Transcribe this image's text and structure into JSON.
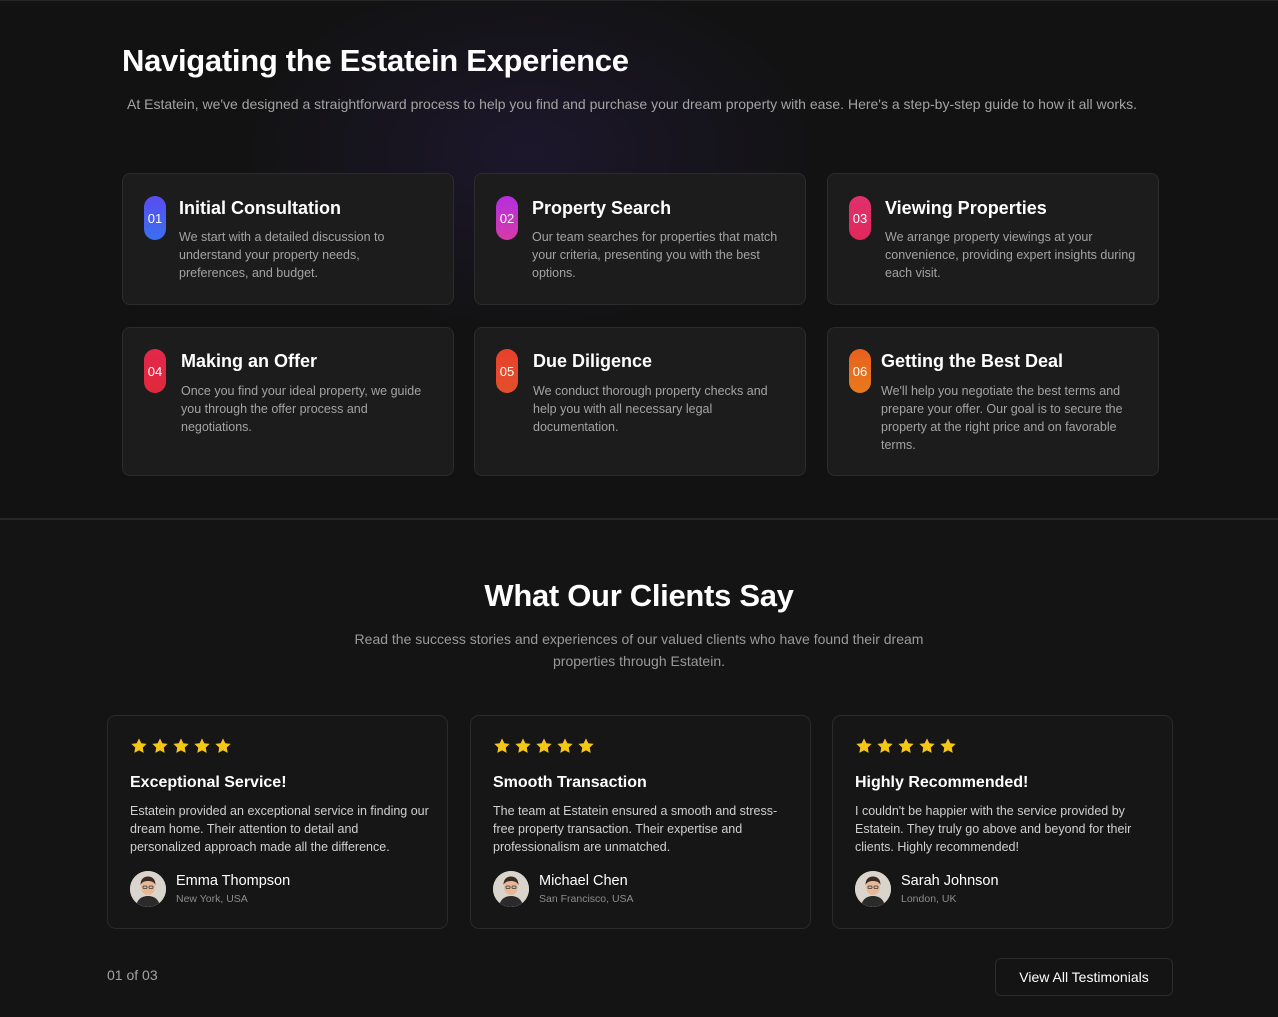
{
  "process": {
    "title": "Navigating the Estatein Experience",
    "subtitle": "At Estatein, we've designed a straightforward process to help you find and purchase your dream property with ease. Here's a step-by-step guide to how it all works.",
    "steps": [
      {
        "num": "01",
        "title": "Initial Consultation",
        "desc": "We start with a detailed discussion to understand your property needs, preferences, and budget.",
        "color_from": "#5a4cf0",
        "color_to": "#3a6ff0"
      },
      {
        "num": "02",
        "title": "Property Search",
        "desc": "Our team searches for properties that match your criteria, presenting you with the best options.",
        "color_from": "#b52ee0",
        "color_to": "#d63aa6"
      },
      {
        "num": "03",
        "title": "Viewing Properties",
        "desc": "We arrange property viewings at your convenience, providing expert insights during each visit.",
        "color_from": "#e0306f",
        "color_to": "#e0285a"
      },
      {
        "num": "04",
        "title": "Making an Offer",
        "desc": "Once you find your ideal property, we guide you through the offer process and negotiations.",
        "color_from": "#e3284a",
        "color_to": "#e0283c"
      },
      {
        "num": "05",
        "title": "Due Diligence",
        "desc": "We conduct thorough property checks and help you with all necessary legal documentation.",
        "color_from": "#e8402c",
        "color_to": "#e2502a"
      },
      {
        "num": "06",
        "title": "Getting the Best Deal",
        "desc": "We'll help you negotiate the best terms and prepare your offer. Our goal is to secure the property at the right price and on favorable terms.",
        "color_from": "#e8601e",
        "color_to": "#e87a1c"
      }
    ]
  },
  "testimonials": {
    "title": "What Our Clients Say",
    "subtitle": "Read the success stories and experiences of our valued clients who have found their dream properties through Estatein.",
    "star_color": "#f5c518",
    "items": [
      {
        "rating": 5,
        "title": "Exceptional Service!",
        "body": "Estatein provided an exceptional service in finding our dream home. Their attention to detail and personalized approach made all the difference.",
        "name": "Emma Thompson",
        "location": "New York, USA"
      },
      {
        "rating": 5,
        "title": "Smooth Transaction",
        "body": "The team at Estatein ensured a smooth and stress-free property transaction. Their expertise and professionalism are unmatched.",
        "name": "Michael Chen",
        "location": "San Francisco, USA"
      },
      {
        "rating": 5,
        "title": "Highly Recommended!",
        "body": "I couldn't be happier with the service provided by Estatein. They truly go above and beyond for their clients. Highly recommended!",
        "name": "Sarah Johnson",
        "location": "London, UK"
      }
    ],
    "pager": "01 of 03",
    "view_all_label": "View All Testimonials"
  }
}
